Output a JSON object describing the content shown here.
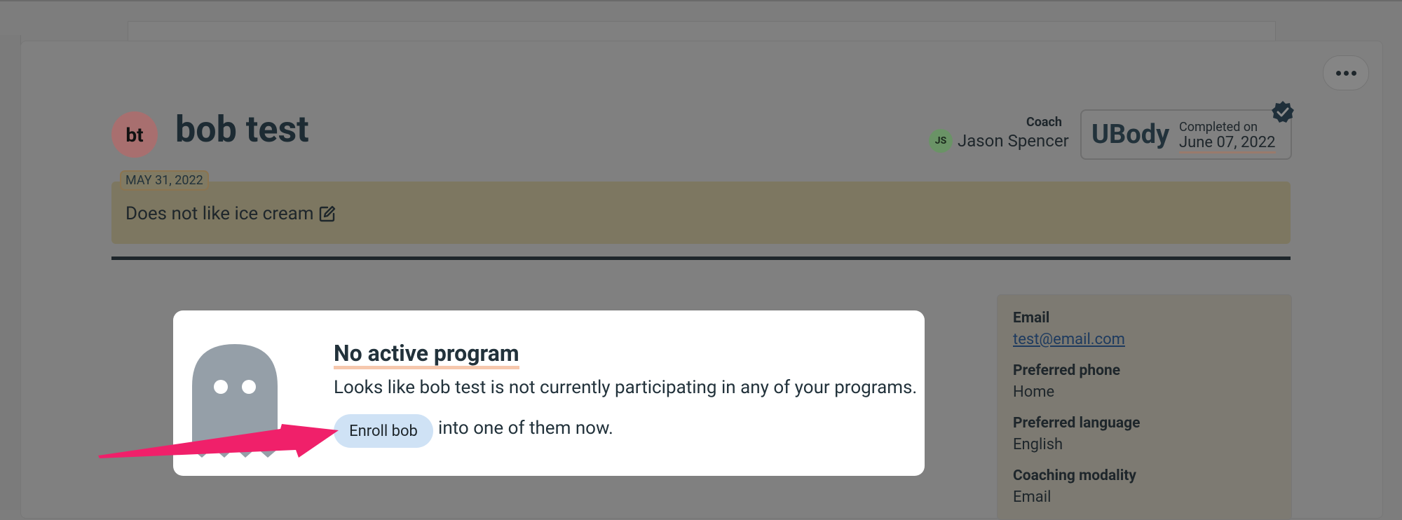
{
  "client": {
    "initials": "bt",
    "name": "bob test"
  },
  "coach": {
    "label": "Coach",
    "initials": "JS",
    "name": "Jason Spencer"
  },
  "program": {
    "name": "UBody",
    "completed_label": "Completed on",
    "completed_date": "June 07, 2022"
  },
  "note": {
    "date": "MAY 31, 2022",
    "text": "Does not like ice cream"
  },
  "info": {
    "email_label": "Email",
    "email_value": "test@email.com",
    "phone_label": "Preferred phone",
    "phone_value": "Home",
    "language_label": "Preferred language",
    "language_value": "English",
    "modality_label": "Coaching modality",
    "modality_value": "Email"
  },
  "modal": {
    "title": "No active program",
    "text": "Looks like bob test is not currently participating in any of your programs.",
    "enroll_label": "Enroll bob",
    "suffix": "into one of them now."
  },
  "colors": {
    "arrow": "#f0206a",
    "enroll_button": "#cfe2f5",
    "ghost": "#959fa8"
  }
}
